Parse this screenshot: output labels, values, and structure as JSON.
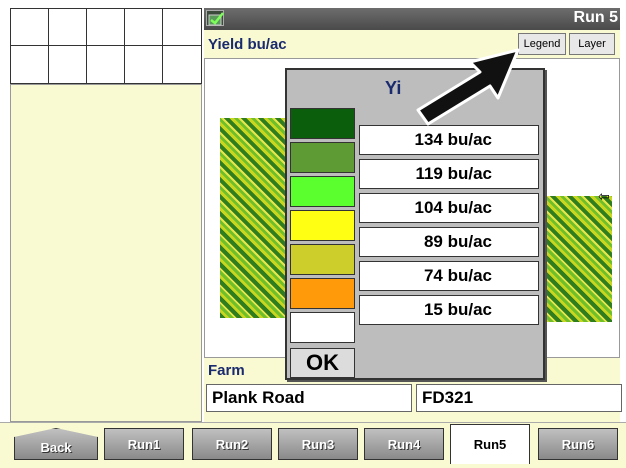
{
  "header": {
    "run_title": "Run 5",
    "layer_title": "Yield bu/ac"
  },
  "toolbar": {
    "legend_label": "Legend",
    "layer_label": "Layer"
  },
  "legend_dialog": {
    "title": "Yi",
    "entries": [
      {
        "color": "#0b5e0b",
        "value": "134  bu/ac"
      },
      {
        "color": "#5f9b35",
        "value": "119  bu/ac"
      },
      {
        "color": "#5cff2e",
        "value": "104  bu/ac"
      },
      {
        "color": "#ffff14",
        "value": "89  bu/ac"
      },
      {
        "color": "#cdcd2b",
        "value": "74  bu/ac"
      },
      {
        "color": "#ff9a0a",
        "value": "15  bu/ac"
      },
      {
        "color": "#ffffff",
        "value": ""
      }
    ],
    "ok_label": "OK"
  },
  "farm": {
    "label": "Farm",
    "farm_value": "Plank Road",
    "field_value": "FD321"
  },
  "tabs": [
    {
      "label": "Back"
    },
    {
      "label": "Run1"
    },
    {
      "label": "Run2"
    },
    {
      "label": "Run3"
    },
    {
      "label": "Run4"
    },
    {
      "label": "Run5",
      "active": true
    },
    {
      "label": "Run6"
    }
  ],
  "colors": {
    "panel_bg": "#fafad2",
    "title_text": "#1a2a6e",
    "title_bar": "#5a5a5a"
  },
  "icons": [
    "check-icon",
    "left-arrow-icon",
    "pointer-arrow-icon"
  ]
}
